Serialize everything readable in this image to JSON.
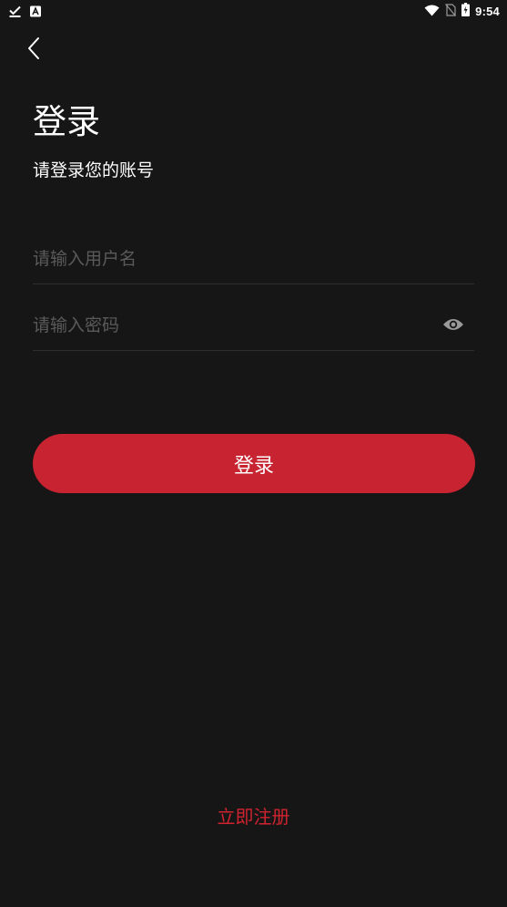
{
  "status_bar": {
    "time": "9:54",
    "icons": [
      "download-done-icon",
      "a-icon",
      "wifi-icon",
      "no-sim-icon",
      "battery-charging-icon"
    ]
  },
  "header": {
    "back_icon": "chevron-left-icon"
  },
  "title": "登录",
  "subtitle": "请登录您的账号",
  "form": {
    "username": {
      "value": "",
      "placeholder": "请输入用户名"
    },
    "password": {
      "value": "",
      "placeholder": "请输入密码",
      "toggle_icon": "eye-icon"
    },
    "submit_label": "登录"
  },
  "register_label": "立即注册",
  "colors": {
    "background": "#161616",
    "accent": "#c72331",
    "link": "#d0232f",
    "placeholder": "#5a5a5a",
    "divider": "#2e2e2e"
  }
}
